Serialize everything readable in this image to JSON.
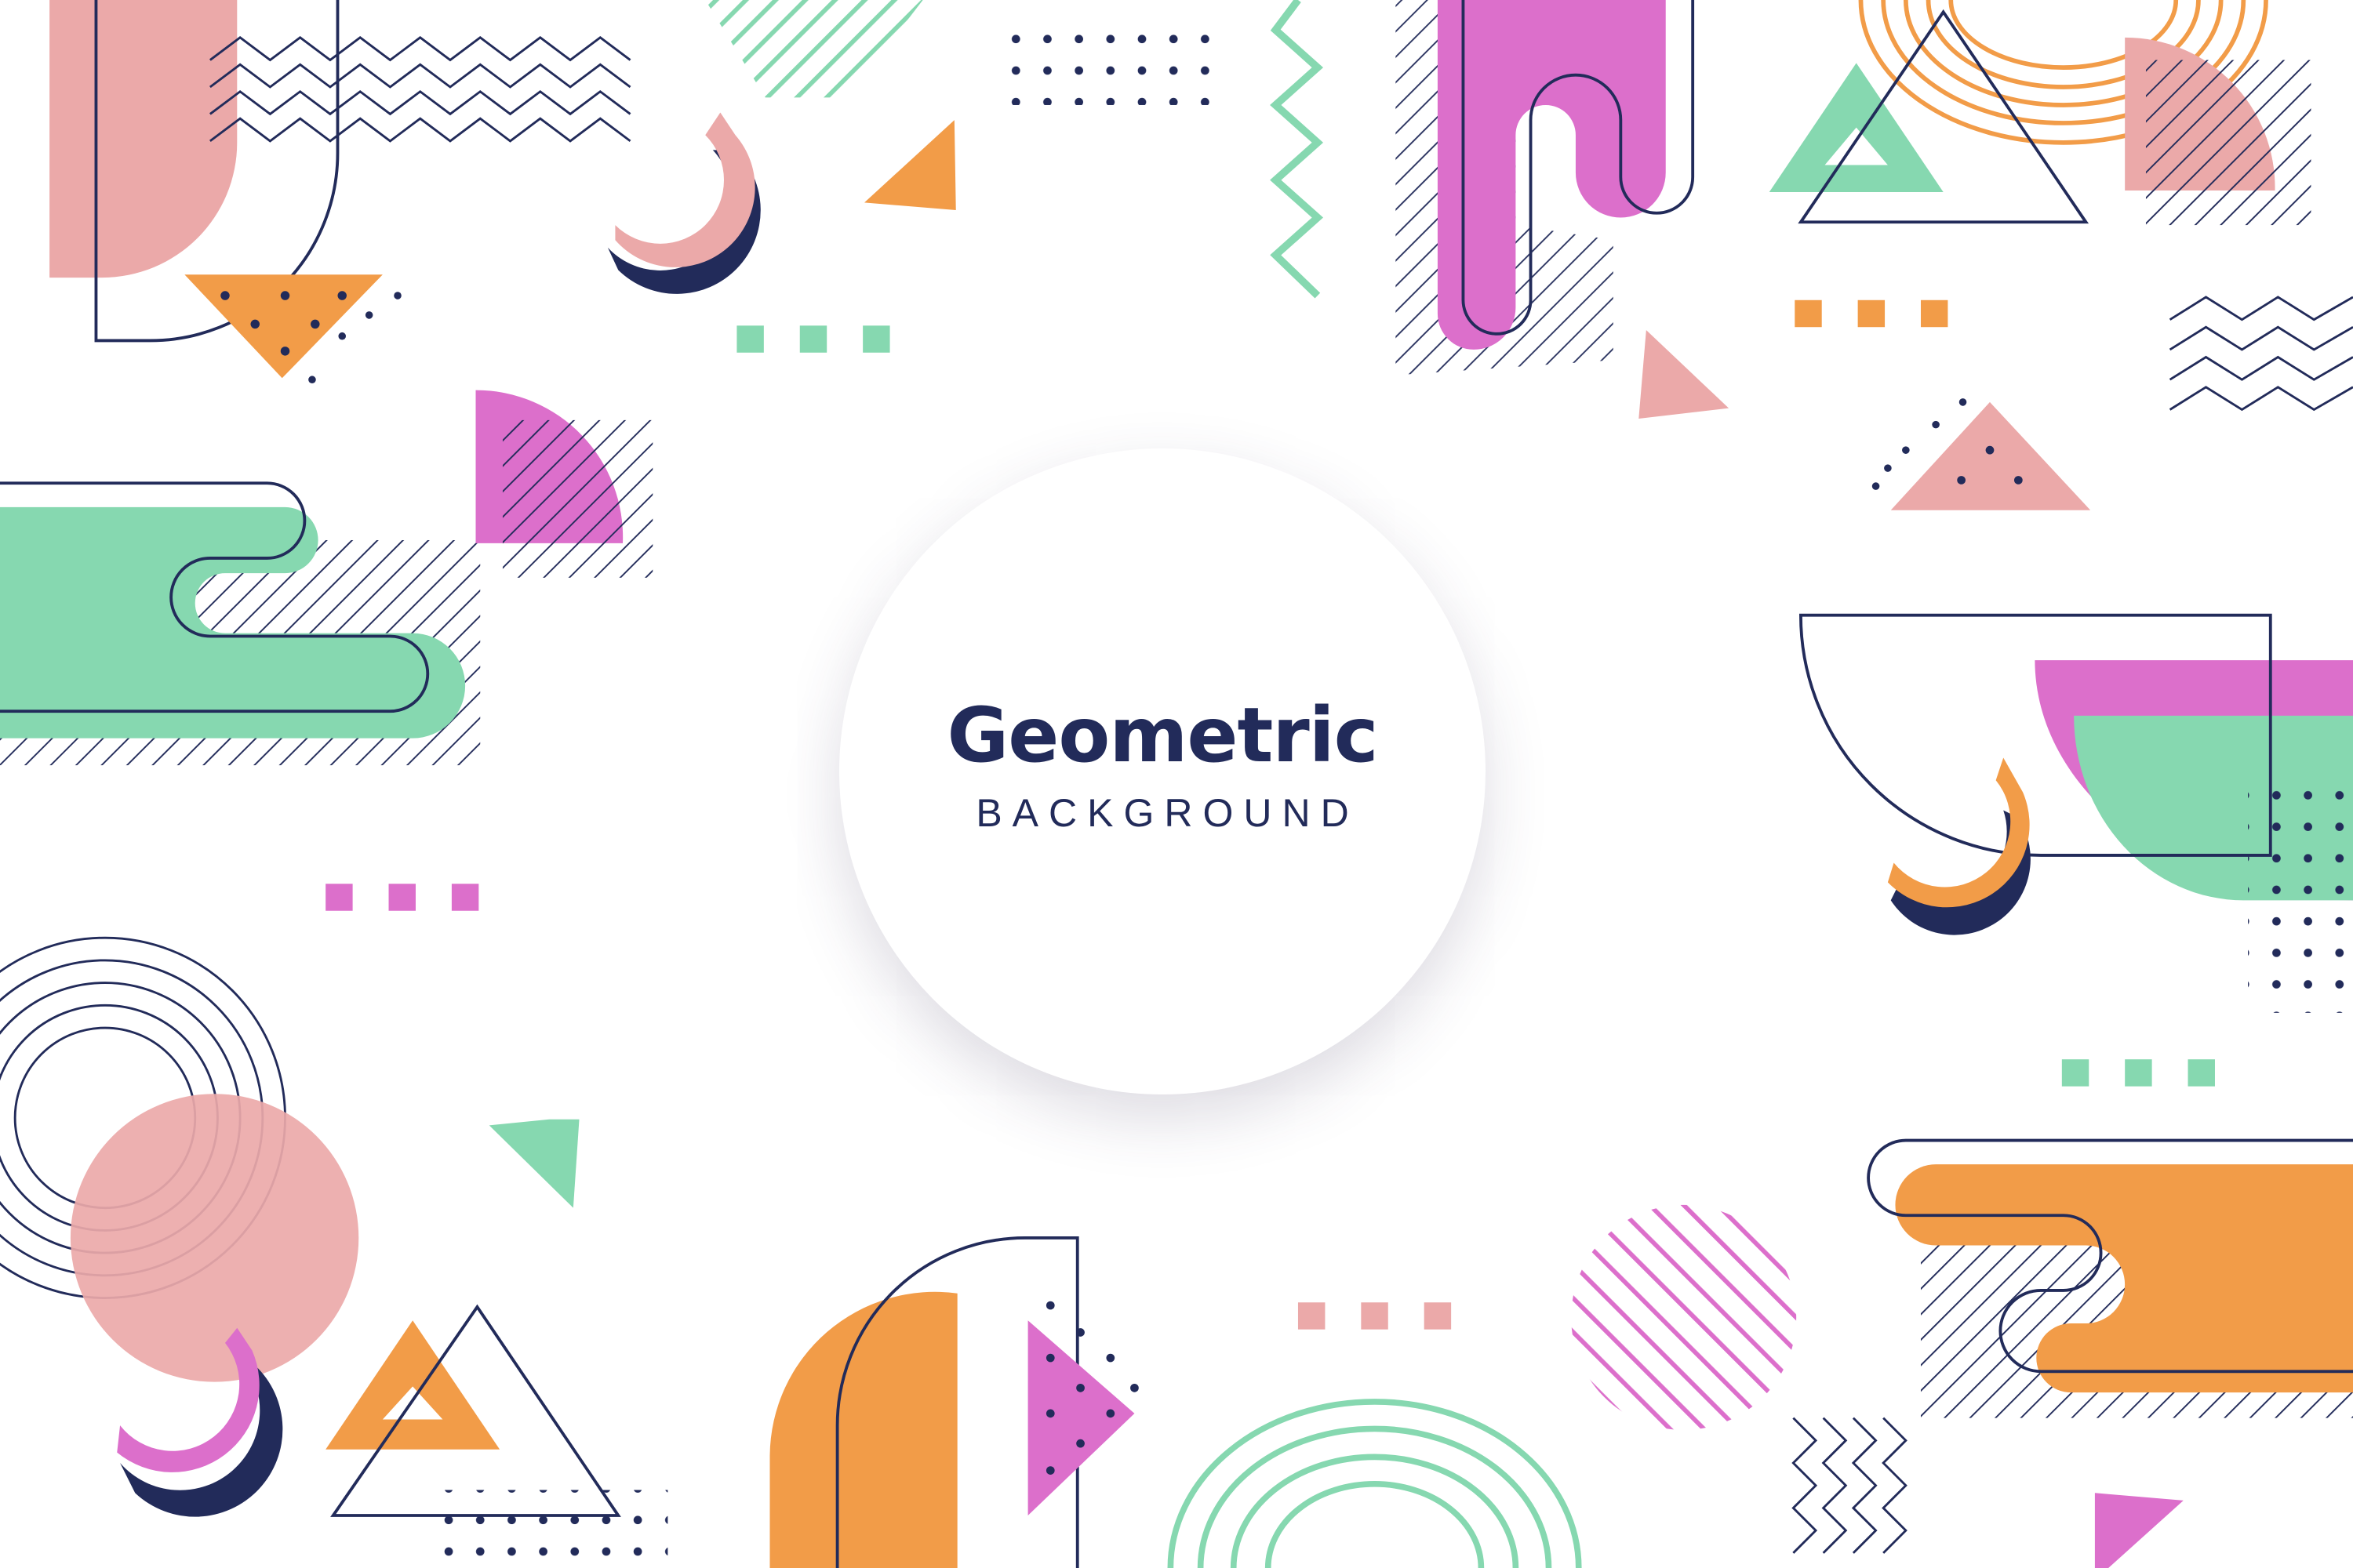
{
  "title": "Geometric",
  "subtitle": "BACKGROUND",
  "colors": {
    "navy": "#222b5a",
    "pink": "#eba9a9",
    "magenta": "#dc6fcb",
    "green": "#86d8b0",
    "orange": "#f29c48"
  }
}
